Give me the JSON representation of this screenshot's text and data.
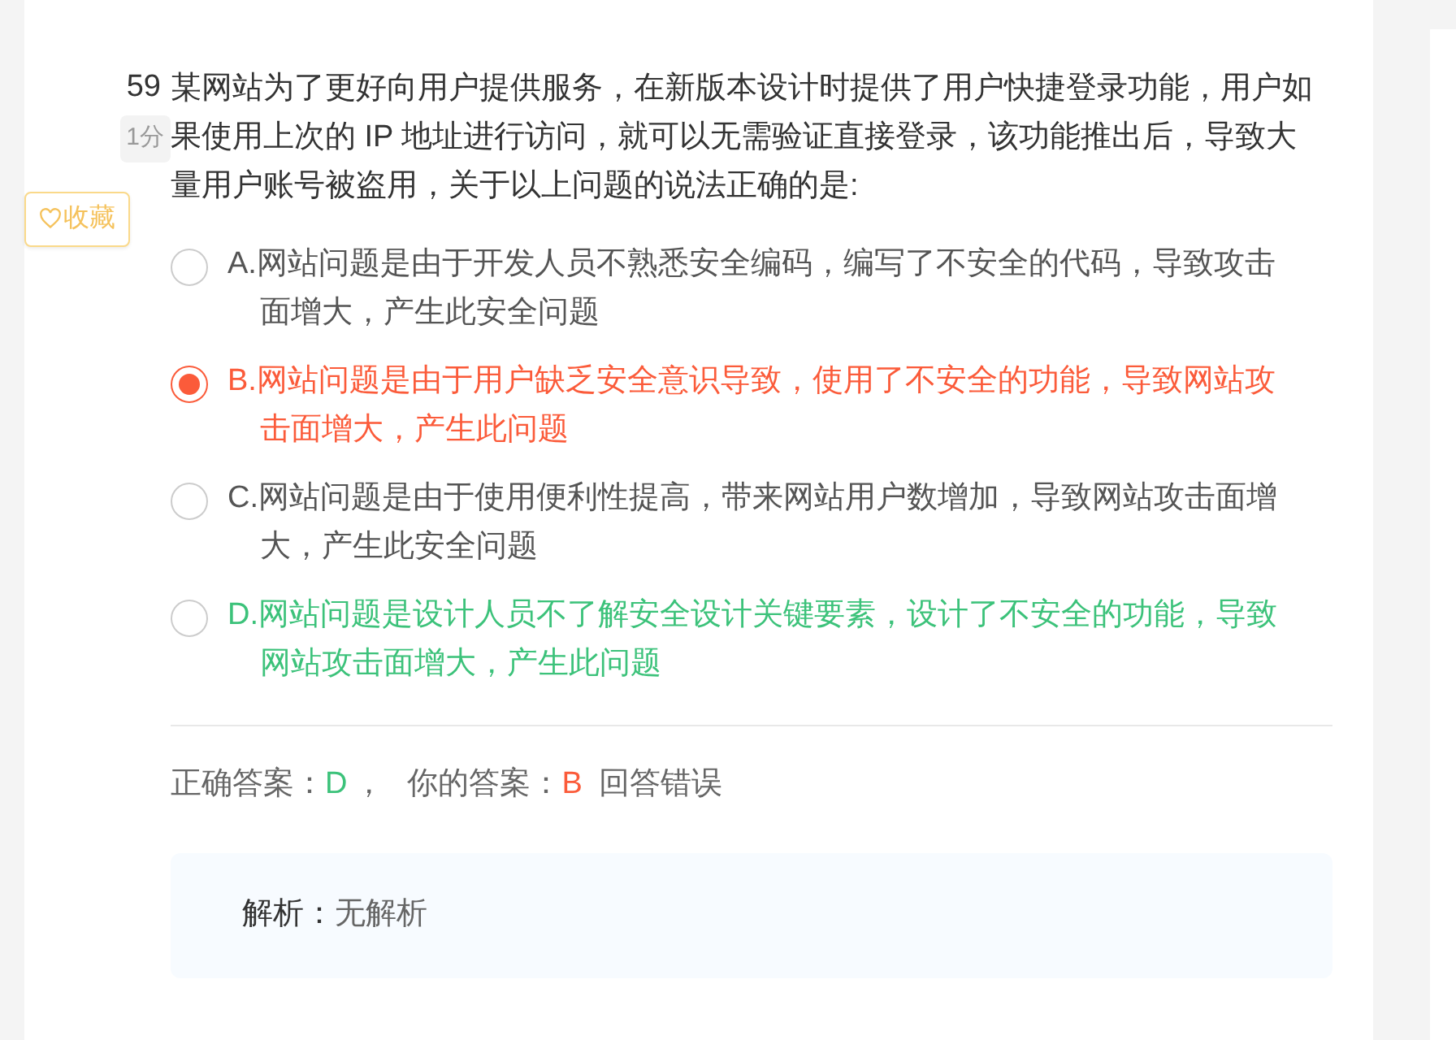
{
  "question": {
    "number": "59",
    "score": "1分",
    "favorite_label": "收藏",
    "favorited": false,
    "text": "某网站为了更好向用户提供服务，在新版本设计时提供了用户快捷登录功能，用户如果使用上次的 IP 地址进行访问，就可以无需验证直接登录，该功能推出后，导致大量用户账号被盗用，关于以上问题的说法正确的是:"
  },
  "options": [
    {
      "label": "A.网站问题是由于开发人员不熟悉安全编码，编写了不安全的代码，导致攻击面增大，产生此安全问题",
      "selected": false,
      "correct": false
    },
    {
      "label": "B.网站问题是由于用户缺乏安全意识导致，使用了不安全的功能，导致网站攻击面增大，产生此问题",
      "selected": true,
      "correct": false
    },
    {
      "label": "C.网站问题是由于使用便利性提高，带来网站用户数增加，导致网站攻击面增大，产生此安全问题",
      "selected": false,
      "correct": false
    },
    {
      "label": "D.网站问题是设计人员不了解安全设计关键要素，设计了不安全的功能，导致网站攻击面增大，产生此问题",
      "selected": false,
      "correct": true
    }
  ],
  "result": {
    "correct_label": "正确答案：",
    "correct_answer": "D",
    "separator": "，",
    "your_label": "你的答案：",
    "your_answer": "B",
    "verdict": "回答错误"
  },
  "analysis": {
    "label": "解析：",
    "text": "无解析"
  }
}
